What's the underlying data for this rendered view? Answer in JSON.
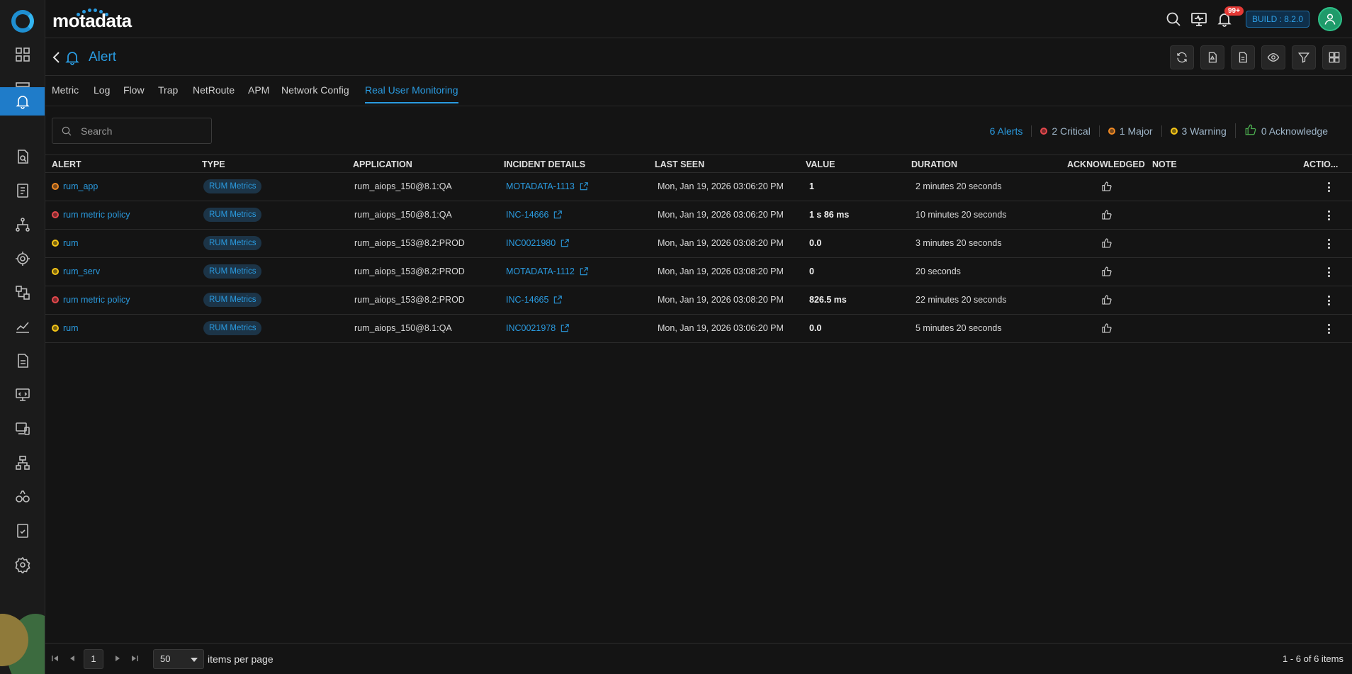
{
  "brand": {
    "name": "motadata"
  },
  "header": {
    "build_label": "BUILD : 8.2.0",
    "notifications_badge": "99+"
  },
  "page": {
    "title": "Alert"
  },
  "tabs": [
    {
      "label": "Metric"
    },
    {
      "label": "Log"
    },
    {
      "label": "Flow"
    },
    {
      "label": "Trap"
    },
    {
      "label": "NetRoute"
    },
    {
      "label": "APM"
    },
    {
      "label": "Network Config"
    },
    {
      "label": "Real User Monitoring"
    }
  ],
  "active_tab": "Real User Monitoring",
  "search": {
    "placeholder": "Search"
  },
  "summary": {
    "total": "6 Alerts",
    "critical": "2 Critical",
    "major": "1 Major",
    "warning": "3 Warning",
    "acknowledge": "0 Acknowledge"
  },
  "colors": {
    "accent": "#2a9be0",
    "critical": "#e5484d",
    "major": "#f08a24",
    "warning": "#f5c518",
    "acknowledge": "#4caf50"
  },
  "table": {
    "columns": [
      "ALERT",
      "TYPE",
      "APPLICATION",
      "INCIDENT DETAILS",
      "LAST SEEN",
      "VALUE",
      "DURATION",
      "ACKNOWLEDGED",
      "NOTE",
      "ACTIO..."
    ],
    "rows": [
      {
        "severity": "major",
        "alert": "rum_app",
        "type": "RUM Metrics",
        "application": "rum_aiops_150@8.1:QA",
        "incident": "MOTADATA-1113",
        "last_seen": "Mon, Jan 19, 2026 03:06:20 PM",
        "value": "1",
        "duration": "2 minutes 20 seconds"
      },
      {
        "severity": "critical",
        "alert": "rum metric policy",
        "type": "RUM Metrics",
        "application": "rum_aiops_150@8.1:QA",
        "incident": "INC-14666",
        "last_seen": "Mon, Jan 19, 2026 03:06:20 PM",
        "value": "1 s 86 ms",
        "duration": "10 minutes 20 seconds"
      },
      {
        "severity": "warning",
        "alert": "rum",
        "type": "RUM Metrics",
        "application": "rum_aiops_153@8.2:PROD",
        "incident": "INC0021980",
        "last_seen": "Mon, Jan 19, 2026 03:08:20 PM",
        "value": "0.0",
        "duration": "3 minutes 20 seconds"
      },
      {
        "severity": "warning",
        "alert": "rum_serv",
        "type": "RUM Metrics",
        "application": "rum_aiops_153@8.2:PROD",
        "incident": "MOTADATA-1112",
        "last_seen": "Mon, Jan 19, 2026 03:08:20 PM",
        "value": "0",
        "duration": "20 seconds"
      },
      {
        "severity": "critical",
        "alert": "rum metric policy",
        "type": "RUM Metrics",
        "application": "rum_aiops_153@8.2:PROD",
        "incident": "INC-14665",
        "last_seen": "Mon, Jan 19, 2026 03:08:20 PM",
        "value": "826.5 ms",
        "duration": "22 minutes 20 seconds"
      },
      {
        "severity": "warning",
        "alert": "rum",
        "type": "RUM Metrics",
        "application": "rum_aiops_150@8.1:QA",
        "incident": "INC0021978",
        "last_seen": "Mon, Jan 19, 2026 03:06:20 PM",
        "value": "0.0",
        "duration": "5 minutes 20 seconds"
      }
    ]
  },
  "pagination": {
    "page": "1",
    "per_page": "50",
    "per_page_label": "items per page",
    "range": "1 - 6 of 6 items"
  }
}
